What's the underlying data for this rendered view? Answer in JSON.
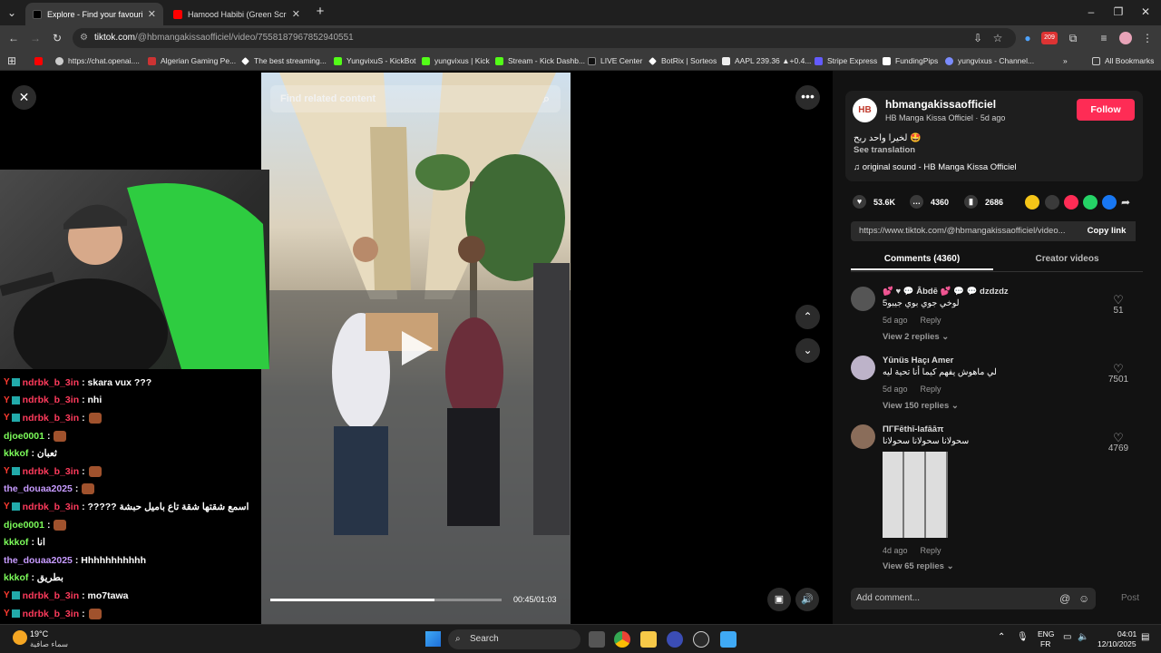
{
  "browser": {
    "tabs": [
      {
        "title": "Explore - Find your favourite vi",
        "active": true
      },
      {
        "title": "Hamood Habibi (Green Screen)",
        "active": false
      }
    ],
    "url_host": "tiktok.com",
    "url_path": "/@hbmangakissaofficiel/video/7558187967852940551",
    "bookmarks": [
      "https://chat.openai....",
      "Algerian Gaming Pe...",
      "The best streaming...",
      "YungvixuS - KickBot",
      "yungvixus | Kick",
      "Stream - Kick Dashb...",
      "LIVE Center",
      "BotRix | Sorteos",
      "AAPL 239.36 ▲+0.4...",
      "Stripe Express",
      "FundingPips",
      "yungvixus - Channel..."
    ],
    "all_bookmarks": "All Bookmarks"
  },
  "video": {
    "search_placeholder": "Find related content",
    "time": "00:45/01:03",
    "progress": 0.71
  },
  "chat": [
    {
      "user": "ndrbk_b_3in",
      "color": "#ff3b5c",
      "badges": true,
      "msg": ": skara vux ???"
    },
    {
      "user": "ndrbk_b_3in",
      "color": "#ff3b5c",
      "badges": true,
      "msg": ": nhi"
    },
    {
      "user": "ndrbk_b_3in",
      "color": "#ff3b5c",
      "badges": true,
      "msg": ":",
      "emote": true
    },
    {
      "user": "djoe0001",
      "color": "#7cfc5a",
      "badges": false,
      "msg": ":",
      "emote": true
    },
    {
      "user": "kkkof",
      "color": "#7cfc5a",
      "badges": false,
      "msg": ": ثعبان"
    },
    {
      "user": "ndrbk_b_3in",
      "color": "#ff3b5c",
      "badges": true,
      "msg": ":",
      "emote": true
    },
    {
      "user": "the_douaa2025",
      "color": "#c79bff",
      "badges": false,
      "msg": ":",
      "emote": true
    },
    {
      "user": "ndrbk_b_3in",
      "color": "#ff3b5c",
      "badges": true,
      "msg": ": ????? اسمع شقتها شقة تاع باميل حبشة"
    },
    {
      "user": "djoe0001",
      "color": "#7cfc5a",
      "badges": false,
      "msg": ":",
      "emote": true
    },
    {
      "user": "kkkof",
      "color": "#7cfc5a",
      "badges": false,
      "msg": ": انا"
    },
    {
      "user": "the_douaa2025",
      "color": "#c79bff",
      "badges": false,
      "msg": ": Hhhhhhhhhhh"
    },
    {
      "user": "kkkof",
      "color": "#7cfc5a",
      "badges": false,
      "msg": ": بطريق"
    },
    {
      "user": "ndrbk_b_3in",
      "color": "#ff3b5c",
      "badges": true,
      "msg": ": mo7tawa"
    },
    {
      "user": "ndrbk_b_3in",
      "color": "#ff3b5c",
      "badges": true,
      "msg": ":",
      "emote": true
    }
  ],
  "post": {
    "avatar_text": "HB",
    "username": "hbmangakissaofficiel",
    "subline": "HB Manga Kissa Officiel · 5d ago",
    "follow": "Follow",
    "caption": "لخيرا واحد ربح 🤩",
    "see_translation": "See translation",
    "sound": "♫  original sound - HB Manga Kissa Officiel",
    "likes": "53.6K",
    "comments_count": "4360",
    "saves": "2686",
    "link": "https://www.tiktok.com/@hbmangakissaofficiel/video...",
    "copy_link": "Copy link",
    "tab_comments": "Comments (4360)",
    "tab_creator": "Creator videos",
    "add_comment": "Add comment...",
    "post_btn": "Post"
  },
  "comments": [
    {
      "user": "💕 ♥ 💬 Âbdē 💕 💬 💬 dzdzdz",
      "text": "لوخي جوي بوي جيبو5",
      "date": "5d ago",
      "reply": "Reply",
      "replies": "View 2 replies ⌄",
      "likes": "51"
    },
    {
      "user": "Yūnüs Haçı Amer",
      "text": "لي ماهوش يفهم كيما أنا تحية ليه",
      "date": "5d ago",
      "reply": "Reply",
      "replies": "View 150 replies ⌄",
      "likes": "7501"
    },
    {
      "user": "ΠΓFēthī-lafāāπ",
      "text": "سحولانا سحولانا سحولانا",
      "date": "4d ago",
      "reply": "Reply",
      "replies": "View 65 replies ⌄",
      "likes": "4769"
    }
  ],
  "taskbar": {
    "weather_temp": "19°C",
    "weather_desc": "سماء صافية",
    "search": "Search",
    "lang1": "ENG",
    "lang2": "FR",
    "time": "04:01",
    "date": "12/10/2025",
    "badge": "209"
  }
}
